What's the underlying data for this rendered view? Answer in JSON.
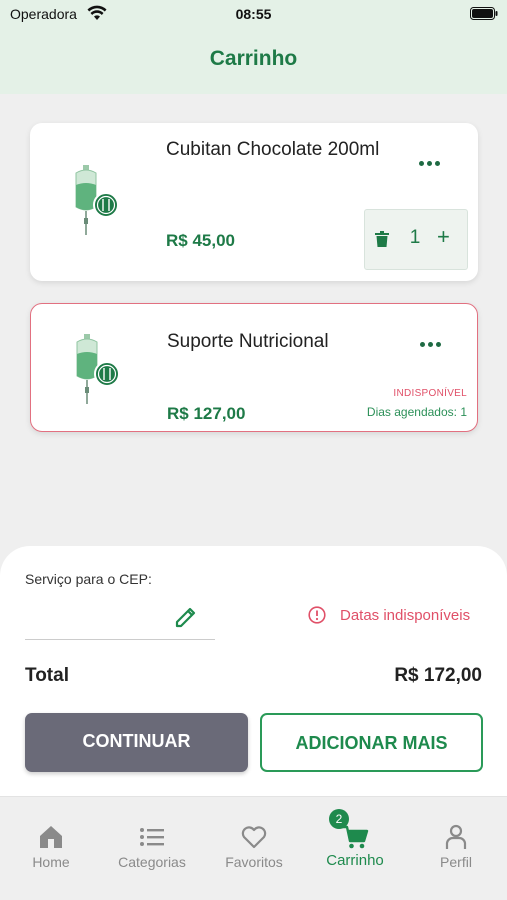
{
  "status_bar": {
    "carrier": "Operadora",
    "time": "08:55"
  },
  "header": {
    "title": "Carrinho"
  },
  "cart_items": [
    {
      "name": "Cubitan Chocolate 200ml",
      "price": "R$ 45,00",
      "quantity": "1",
      "image_icon": "iv-bag-food-icon"
    },
    {
      "name": "Suporte Nutricional",
      "price": "R$ 127,00",
      "status": "INDISPONÍVEL",
      "scheduled_days": "Dias agendados: 1",
      "image_icon": "iv-bag-food-icon"
    }
  ],
  "summary": {
    "cep_label": "Serviço para o CEP:",
    "cep_value": "",
    "dates_warning": "Datas indisponíveis",
    "total_label": "Total",
    "total_value": "R$ 172,00",
    "continue_label": "CONTINUAR",
    "add_more_label": "ADICIONAR MAIS"
  },
  "tabbar": {
    "tabs": [
      {
        "label": "Home",
        "icon": "home-icon"
      },
      {
        "label": "Categorias",
        "icon": "list-icon"
      },
      {
        "label": "Favoritos",
        "icon": "heart-icon"
      },
      {
        "label": "Carrinho",
        "icon": "cart-icon",
        "active": true,
        "badge": "2"
      },
      {
        "label": "Perfil",
        "icon": "person-icon"
      }
    ]
  },
  "colors": {
    "brand_green": "#1e7a47",
    "header_bg": "#e4f1e7",
    "error_red": "#e05068",
    "inactive_gray": "#8a8a8a"
  }
}
